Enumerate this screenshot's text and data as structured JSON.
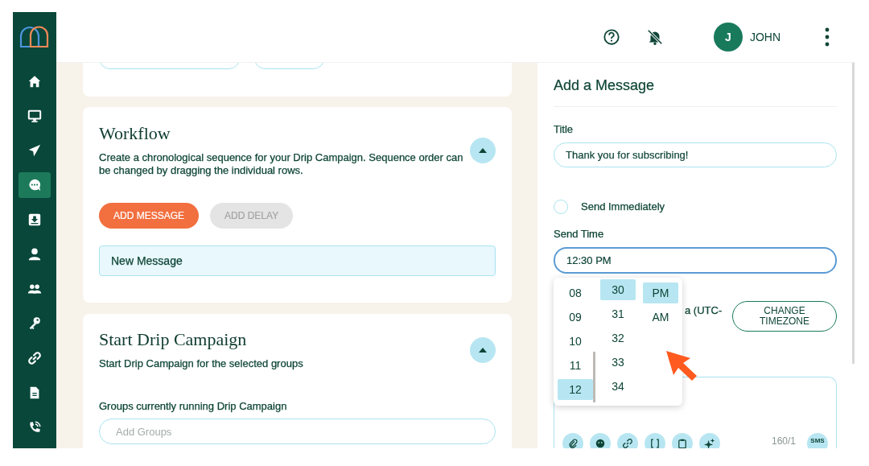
{
  "sidebar": {
    "items": [
      {
        "selected": false
      },
      {
        "selected": false
      },
      {
        "selected": false
      },
      {
        "selected": true
      },
      {
        "selected": false
      },
      {
        "selected": false
      },
      {
        "selected": false
      },
      {
        "selected": false
      },
      {
        "selected": false
      },
      {
        "selected": false
      },
      {
        "selected": false
      }
    ]
  },
  "header": {
    "avatar_initial": "J",
    "user_name": "JOHN"
  },
  "workflow": {
    "title": "Workflow",
    "description": "Create a chronological sequence for your Drip Campaign. Sequence order can be changed by dragging the individual rows.",
    "expanded": true,
    "buttons": [
      {
        "label": "ADD MESSAGE",
        "disabled": false
      },
      {
        "label": "ADD DELAY",
        "disabled": true
      }
    ],
    "rows": [
      {
        "label": "New Message"
      }
    ]
  },
  "drip_campaign": {
    "title": "Start Drip Campaign",
    "description": "Start Drip Campaign for the selected groups",
    "expanded": true,
    "groups_label": "Groups currently running Drip Campaign",
    "groups_placeholder": "Add Groups"
  },
  "message_panel": {
    "title": "Add a Message",
    "title_label": "Title",
    "title_value": "Thank you for subscribing!",
    "send_immediately": {
      "label": "Send Immediately",
      "checked": false
    },
    "send_time_label": "Send Time",
    "send_time_value": "12:30 PM",
    "timezone_text": "a (UTC-",
    "timezone_button": "CHANGE TIMEZONE",
    "time_picker": {
      "hours": [
        {
          "label": "08",
          "selected": false
        },
        {
          "label": "09",
          "selected": false
        },
        {
          "label": "10",
          "selected": false
        },
        {
          "label": "11",
          "selected": false
        },
        {
          "label": "12",
          "selected": true
        }
      ],
      "minutes": [
        {
          "label": "30",
          "selected": true
        },
        {
          "label": "31",
          "selected": false
        },
        {
          "label": "32",
          "selected": false
        },
        {
          "label": "33",
          "selected": false
        },
        {
          "label": "34",
          "selected": false
        }
      ],
      "periods": [
        {
          "label": "PM",
          "selected": true
        },
        {
          "label": "AM",
          "selected": false
        }
      ]
    },
    "char_count": "160/1",
    "sms_badge": "SMS"
  }
}
